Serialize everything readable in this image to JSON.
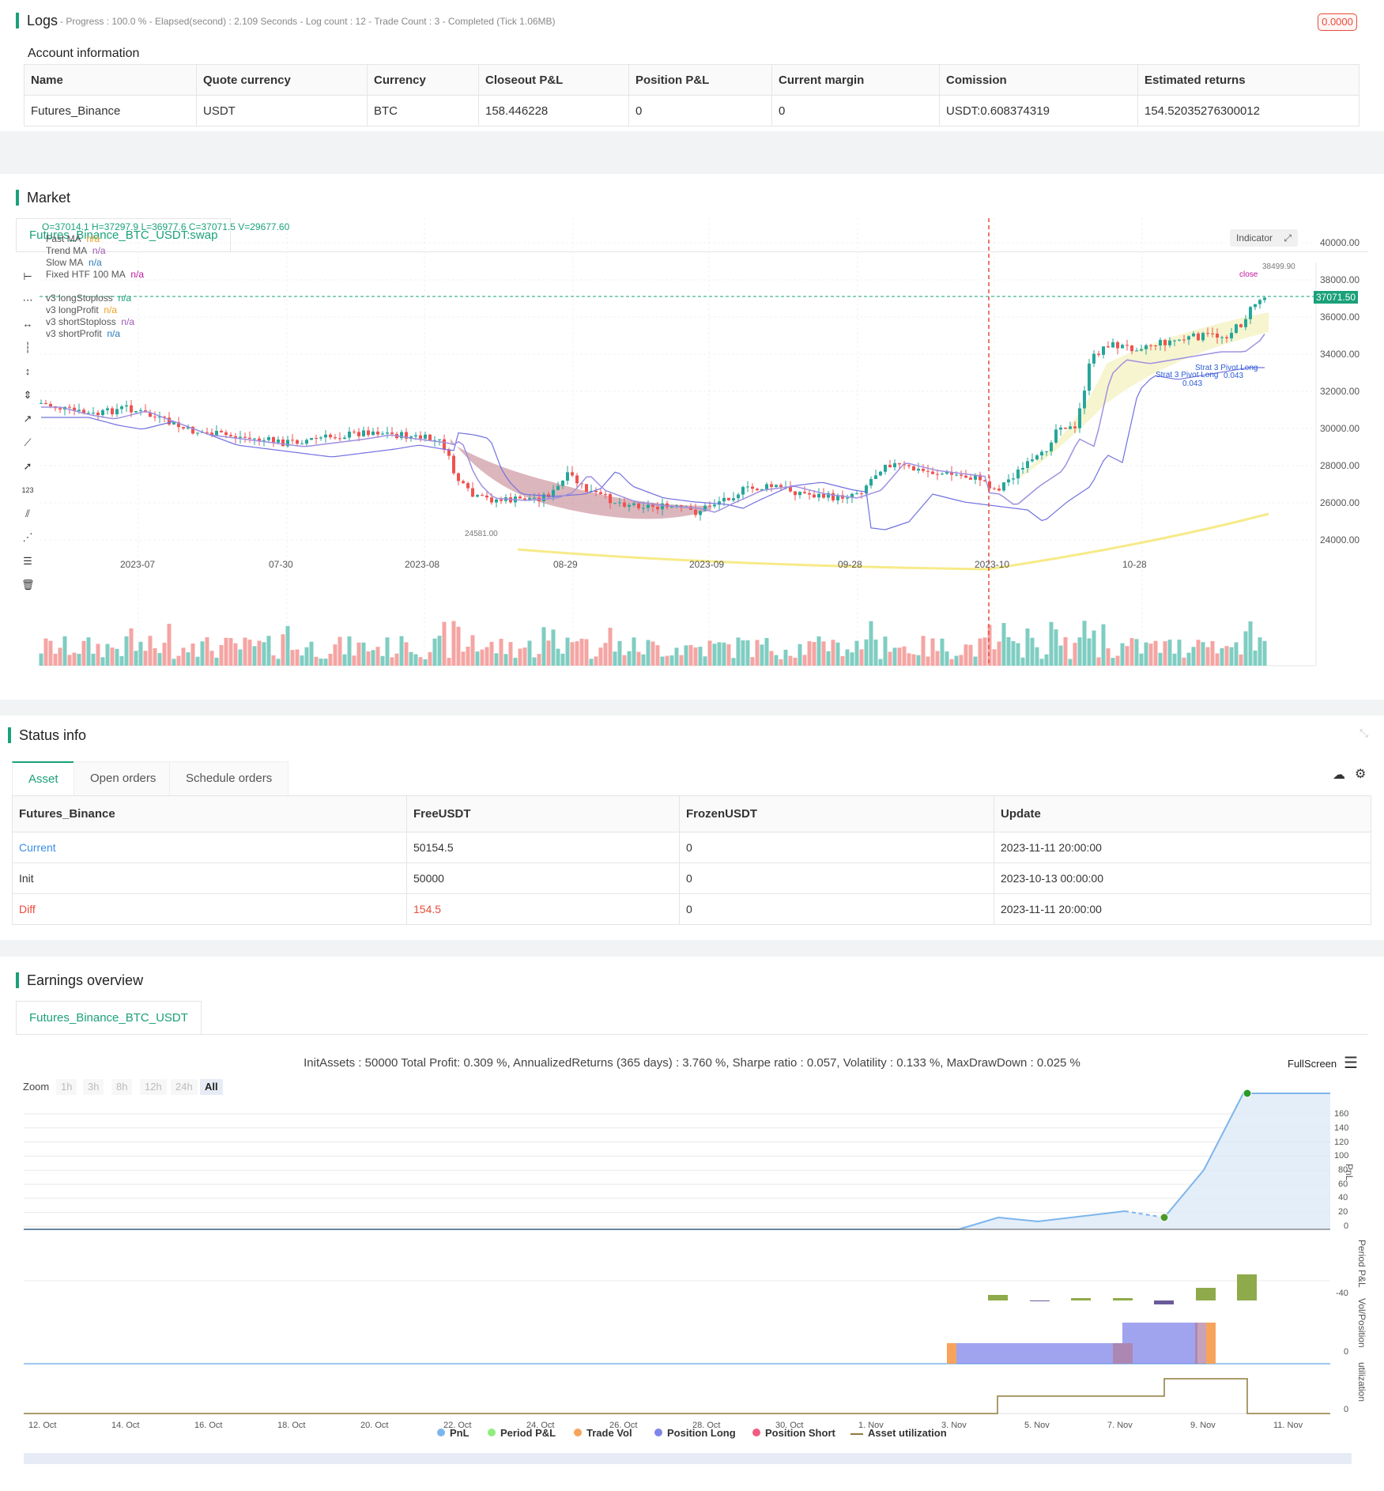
{
  "logs": {
    "title": "Logs",
    "summary": "- Progress : 100.0 % - Elapsed(second) : 2.109 Seconds - Log count : 12 - Trade Count : 3 - Completed (Tick 1.06MB)",
    "badge": "0.0000"
  },
  "account": {
    "title": "Account information",
    "headers": [
      "Name",
      "Quote currency",
      "Currency",
      "Closeout P&L",
      "Position P&L",
      "Current margin",
      "Comission",
      "Estimated returns"
    ],
    "row": [
      "Futures_Binance",
      "USDT",
      "BTC",
      "158.446228",
      "0",
      "0",
      "USDT:0.608374319",
      "154.52035276300012"
    ]
  },
  "market": {
    "title": "Market",
    "tab": "Futures_Binance_BTC_USDT:swap",
    "ohlc": "O=37014.1 H=37297.9 L=36977.6 C=37071.5 V=29677.60",
    "indicator_btn": "Indicator",
    "legend": [
      {
        "name": "Fast MA",
        "value": "n/a",
        "color": "#f0a020"
      },
      {
        "name": "Trend MA",
        "value": "n/a",
        "color": "#9b59b6"
      },
      {
        "name": "Slow MA",
        "value": "n/a",
        "color": "#2a7ab8"
      },
      {
        "name": "Fixed HTF 100 MA",
        "value": "n/a",
        "color": "#c0169b"
      },
      {
        "name": "v3 longStoploss",
        "value": "n/a",
        "color": "#1aa179"
      },
      {
        "name": "v3 longProfit",
        "value": "n/a",
        "color": "#f0a020"
      },
      {
        "name": "v3 shortStoploss",
        "value": "n/a",
        "color": "#9b59b6"
      },
      {
        "name": "v3 shortProfit",
        "value": "n/a",
        "color": "#2a7ab8"
      }
    ],
    "price_labels": [
      "40000.00",
      "38000.00",
      "36000.00",
      "34000.00",
      "32000.00",
      "30000.00",
      "28000.00",
      "26000.00",
      "24000.00"
    ],
    "last_price": "37071.50",
    "high_label": "38499.90",
    "low_label": "24581.00",
    "date_labels": [
      "2023-07",
      "07-30",
      "2023-08",
      "08-29",
      "2023-09",
      "09-28",
      "2023-10",
      "10-28"
    ],
    "annotations": [
      "close",
      "Strat 3 Pivot Long",
      "0.043",
      "Strat 3 Pivot Long",
      "0.043"
    ]
  },
  "status": {
    "title": "Status info",
    "tabs": [
      "Asset",
      "Open orders",
      "Schedule orders"
    ],
    "headers": [
      "Futures_Binance",
      "FreeUSDT",
      "FrozenUSDT",
      "Update"
    ],
    "rows": [
      [
        "Current",
        "50154.5",
        "0",
        "2023-11-11 20:00:00"
      ],
      [
        "Init",
        "50000",
        "0",
        "2023-10-13 00:00:00"
      ],
      [
        "Diff",
        "154.5",
        "0",
        "2023-11-11 20:00:00"
      ]
    ]
  },
  "earnings": {
    "title": "Earnings overview",
    "tab": "Futures_Binance_BTC_USDT",
    "summary": "InitAssets : 50000 Total Profit: 0.309 %, AnnualizedReturns (365 days) : 3.760 %, Sharpe ratio : 0.057, Volatility : 0.133 %, MaxDrawDown : 0.025 %",
    "fullscreen": "FullScreen",
    "zoom_label": "Zoom",
    "zoom_buttons": [
      "1h",
      "3h",
      "8h",
      "12h",
      "24h",
      "All"
    ],
    "pnl_ticks": [
      "160",
      "140",
      "120",
      "100",
      "80",
      "60",
      "40",
      "20",
      "0"
    ],
    "axis_titles": [
      "PnL",
      "Period P&L",
      "Vol/Position",
      "utilization"
    ],
    "period_tick": "-40",
    "zero": "0",
    "x_labels": [
      "12. Oct",
      "14. Oct",
      "16. Oct",
      "18. Oct",
      "20. Oct",
      "22. Oct",
      "24. Oct",
      "26. Oct",
      "28. Oct",
      "30. Oct",
      "1. Nov",
      "3. Nov",
      "5. Nov",
      "7. Nov",
      "9. Nov",
      "11. Nov"
    ],
    "legend": [
      {
        "name": "PnL",
        "color": "#7cb5ec"
      },
      {
        "name": "Period P&L",
        "color": "#90ed7d"
      },
      {
        "name": "Trade Vol",
        "color": "#f7a35c"
      },
      {
        "name": "Position Long",
        "color": "#8085e9"
      },
      {
        "name": "Position Short",
        "color": "#f15c80"
      },
      {
        "name": "Asset utilization",
        "color": "#8d7b3a"
      }
    ]
  }
}
